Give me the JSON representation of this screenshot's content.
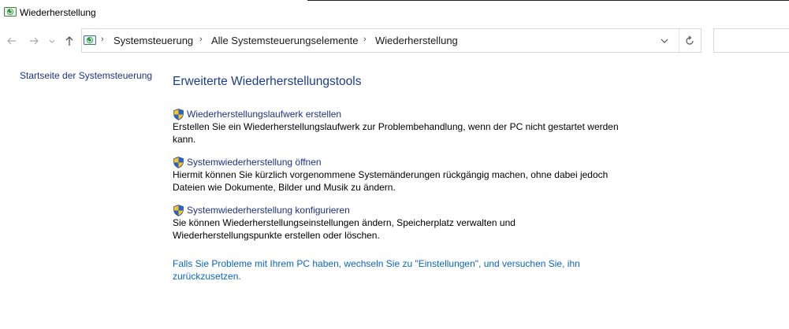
{
  "window": {
    "title": "Wiederherstellung"
  },
  "navigation": {
    "back_icon": "arrow-left-icon",
    "forward_icon": "arrow-right-icon",
    "recent_icon": "chevron-down-icon",
    "up_icon": "arrow-up-icon",
    "breadcrumbs": [
      "Systemsteuerung",
      "Alle Systemsteuerungselemente",
      "Wiederherstellung"
    ],
    "refresh_icon": "refresh-icon",
    "search_placeholder": ""
  },
  "sidebar": {
    "home_link": "Startseite der Systemsteuerung"
  },
  "main": {
    "heading": "Erweiterte Wiederherstellungstools",
    "tasks": [
      {
        "label": "Wiederherstellungslaufwerk erstellen",
        "description": "Erstellen Sie ein Wiederherstellungslaufwerk zur Problembehandlung, wenn der PC nicht gestartet werden kann."
      },
      {
        "label": "Systemwiederherstellung öffnen",
        "description": "Hiermit können Sie kürzlich vorgenommene Systemänderungen rückgängig machen, ohne dabei jedoch Dateien wie Dokumente, Bilder und Musik zu ändern."
      },
      {
        "label": "Systemwiederherstellung konfigurieren",
        "description": "Sie können Wiederherstellungseinstellungen ändern, Speicherplatz verwalten und Wiederherstellungspunkte erstellen oder löschen."
      }
    ],
    "footer_link": "Falls Sie Probleme mit Ihrem PC haben, wechseln Sie zu \"Einstellungen\", und versuchen Sie, ihn zurückzusetzen."
  },
  "colors": {
    "link": "#1e3287",
    "heading": "#1b3d8f",
    "footer_link": "#0a66c8",
    "shield_blue": "#2a62c9",
    "shield_yellow": "#f5c518"
  }
}
